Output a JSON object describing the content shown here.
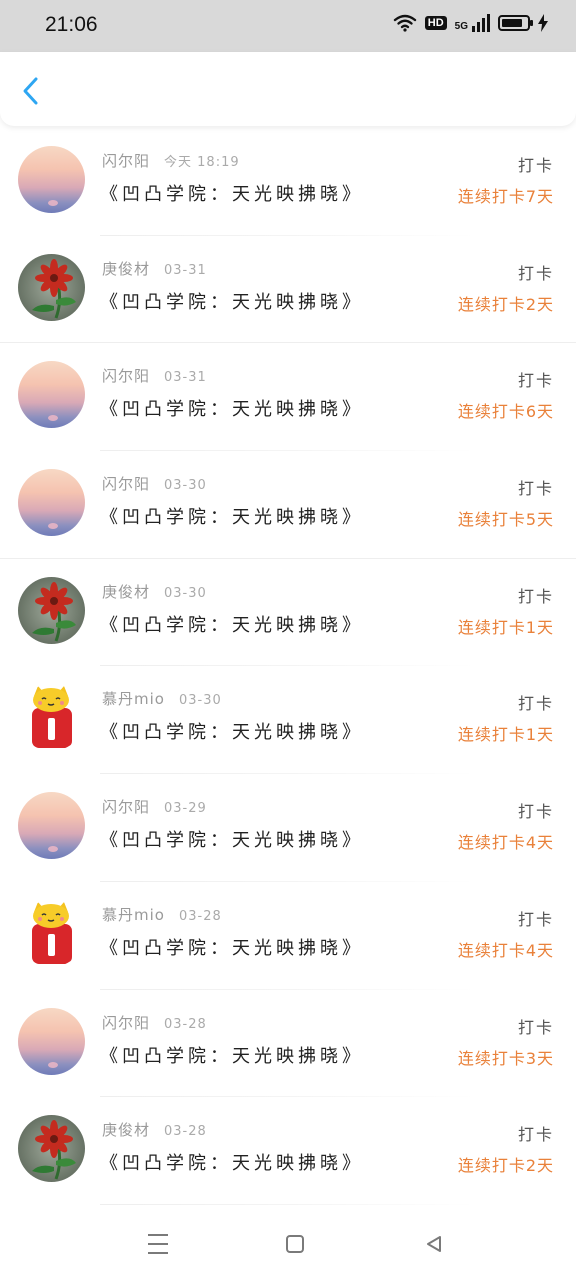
{
  "status_bar": {
    "time": "21:06",
    "network_label": "5G",
    "hd_label": "HD",
    "icons": [
      "wifi-icon",
      "hd-icon",
      "signal-icon",
      "battery-icon",
      "charging-icon"
    ]
  },
  "header": {
    "back_icon": "chevron-left-icon",
    "accent_color": "#2ea6f2"
  },
  "list": {
    "items": [
      {
        "name": "闪尔阳",
        "date": "今天 18:19",
        "title": "《凹凸学院：天光映拂晓》",
        "action": "打卡",
        "streak": "连续打卡7天",
        "avatar": "sunset"
      },
      {
        "name": "庚俊材",
        "date": "03-31",
        "title": "《凹凸学院：天光映拂晓》",
        "action": "打卡",
        "streak": "连续打卡2天",
        "avatar": "flower"
      },
      {
        "name": "闪尔阳",
        "date": "03-31",
        "title": "《凹凸学院：天光映拂晓》",
        "action": "打卡",
        "streak": "连续打卡6天",
        "avatar": "sunset"
      },
      {
        "name": "闪尔阳",
        "date": "03-30",
        "title": "《凹凸学院：天光映拂晓》",
        "action": "打卡",
        "streak": "连续打卡5天",
        "avatar": "sunset"
      },
      {
        "name": "庚俊材",
        "date": "03-30",
        "title": "《凹凸学院：天光映拂晓》",
        "action": "打卡",
        "streak": "连续打卡1天",
        "avatar": "flower"
      },
      {
        "name": "慕丹mio",
        "date": "03-30",
        "title": "《凹凸学院：天光映拂晓》",
        "action": "打卡",
        "streak": "连续打卡1天",
        "avatar": "cat"
      },
      {
        "name": "闪尔阳",
        "date": "03-29",
        "title": "《凹凸学院：天光映拂晓》",
        "action": "打卡",
        "streak": "连续打卡4天",
        "avatar": "sunset"
      },
      {
        "name": "慕丹mio",
        "date": "03-28",
        "title": "《凹凸学院：天光映拂晓》",
        "action": "打卡",
        "streak": "连续打卡4天",
        "avatar": "cat"
      },
      {
        "name": "闪尔阳",
        "date": "03-28",
        "title": "《凹凸学院：天光映拂晓》",
        "action": "打卡",
        "streak": "连续打卡3天",
        "avatar": "sunset"
      },
      {
        "name": "庚俊材",
        "date": "03-28",
        "title": "《凹凸学院：天光映拂晓》",
        "action": "打卡",
        "streak": "连续打卡2天",
        "avatar": "flower"
      }
    ]
  },
  "colors": {
    "streak_orange": "#e9813a",
    "status_bar_bg": "#d9d9d9"
  },
  "nav_bar": {
    "icons": [
      "menu-icon",
      "home-square-icon",
      "back-triangle-icon"
    ]
  }
}
